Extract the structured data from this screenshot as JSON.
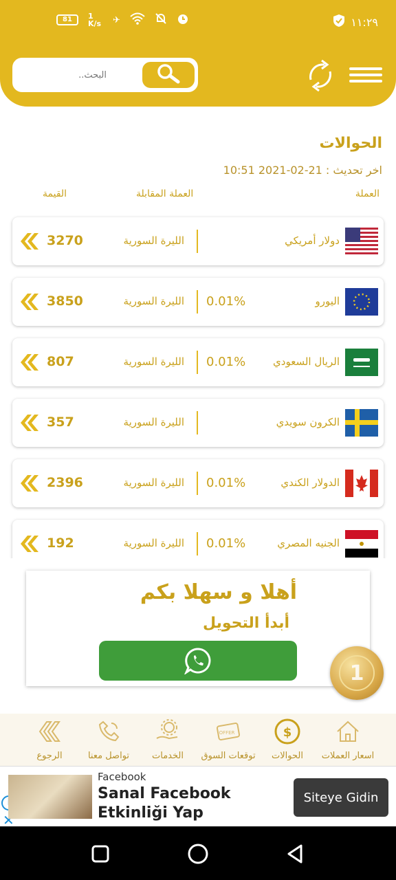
{
  "status_bar": {
    "time": "١١:٢٩",
    "battery": "81",
    "speed": "1 K/s"
  },
  "header": {
    "search_placeholder": "البحث.."
  },
  "page": {
    "title": "الحوالات",
    "last_update": "اخر تحديث : 21-02-2021 10:51",
    "col_currency": "العملة",
    "col_counter": "العملة المقابلة",
    "col_value": "القيمة"
  },
  "rows": [
    {
      "name": "دولار أمريكي",
      "target": "الليرة السورية",
      "pct": "",
      "value": "3270",
      "flag": "us-flag-icon"
    },
    {
      "name": "اليورو",
      "target": "الليرة السورية",
      "pct": "0.01%",
      "value": "3850",
      "flag": "eu-flag-icon"
    },
    {
      "name": "الريال السعودي",
      "target": "الليرة السورية",
      "pct": "0.01%",
      "value": "807",
      "flag": "sa-flag-icon"
    },
    {
      "name": "الكرون سويدي",
      "target": "الليرة السورية",
      "pct": "",
      "value": "357",
      "flag": "se-flag-icon"
    },
    {
      "name": "الدولار الكندي",
      "target": "الليرة السورية",
      "pct": "0.01%",
      "value": "2396",
      "flag": "ca-flag-icon"
    },
    {
      "name": "الجنيه المصري",
      "target": "الليرة السورية",
      "pct": "0.01%",
      "value": "192",
      "flag": "eg-flag-icon"
    }
  ],
  "promo": {
    "title": "أهلا و سهلا بكم",
    "subtitle": "أبدأ التحويل"
  },
  "bottom_nav": [
    {
      "label": "اسعار العملات",
      "icon": "home-icon"
    },
    {
      "label": "الحوالات",
      "icon": "money-transfer-icon"
    },
    {
      "label": "توقعات السوق",
      "icon": "offer-card-icon"
    },
    {
      "label": "الخدمات",
      "icon": "services-gear-icon"
    },
    {
      "label": "تواصل معنا",
      "icon": "phone-icon"
    },
    {
      "label": "الرجوع",
      "icon": "back-chevrons-icon"
    }
  ],
  "ad": {
    "source": "Facebook",
    "headline": "Sanal Facebook Etkinliği Yap",
    "cta": "Siteye Gidin"
  },
  "colors": {
    "brand_gold": "#e3b81f",
    "text_gold": "#c9a11c",
    "whatsapp_green": "#3f9d3a"
  }
}
